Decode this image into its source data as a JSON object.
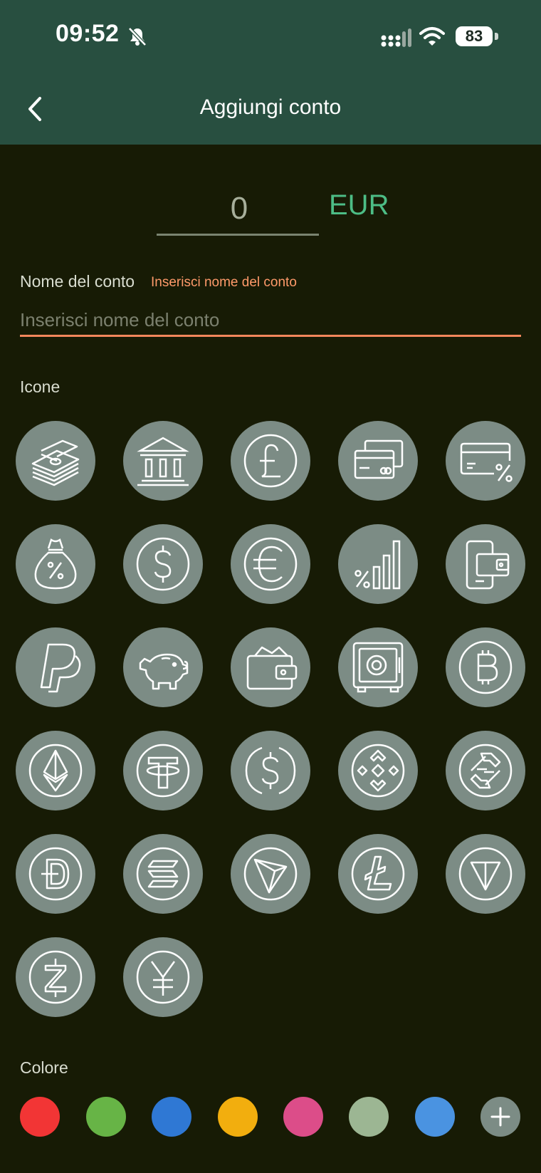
{
  "status_bar": {
    "time": "09:52",
    "battery": "83"
  },
  "header": {
    "title": "Aggiungi conto"
  },
  "amount": {
    "value": "0",
    "currency": "EUR"
  },
  "account_name": {
    "label": "Nome del conto",
    "error": "Inserisci nome del conto",
    "placeholder": "Inserisci nome del conto"
  },
  "icons_section": {
    "label": "Icone",
    "icons": [
      "cash-stack",
      "bank",
      "pound",
      "credit-cards",
      "card-percent",
      "money-bag-percent",
      "dollar",
      "euro",
      "percent-chart",
      "phone-wallet",
      "paypal",
      "piggy-bank",
      "wallet",
      "safe",
      "bitcoin",
      "ethereum",
      "tether",
      "usd-coin",
      "binance",
      "bitget",
      "dogecoin",
      "solana",
      "tron",
      "litecoin",
      "toncoin",
      "zcash",
      "yen"
    ]
  },
  "colors_section": {
    "label": "Colore",
    "colors": [
      "#f23535",
      "#67b446",
      "#2f78d4",
      "#f2ae0e",
      "#dc4d89",
      "#9cb693",
      "#4a93e1"
    ]
  }
}
